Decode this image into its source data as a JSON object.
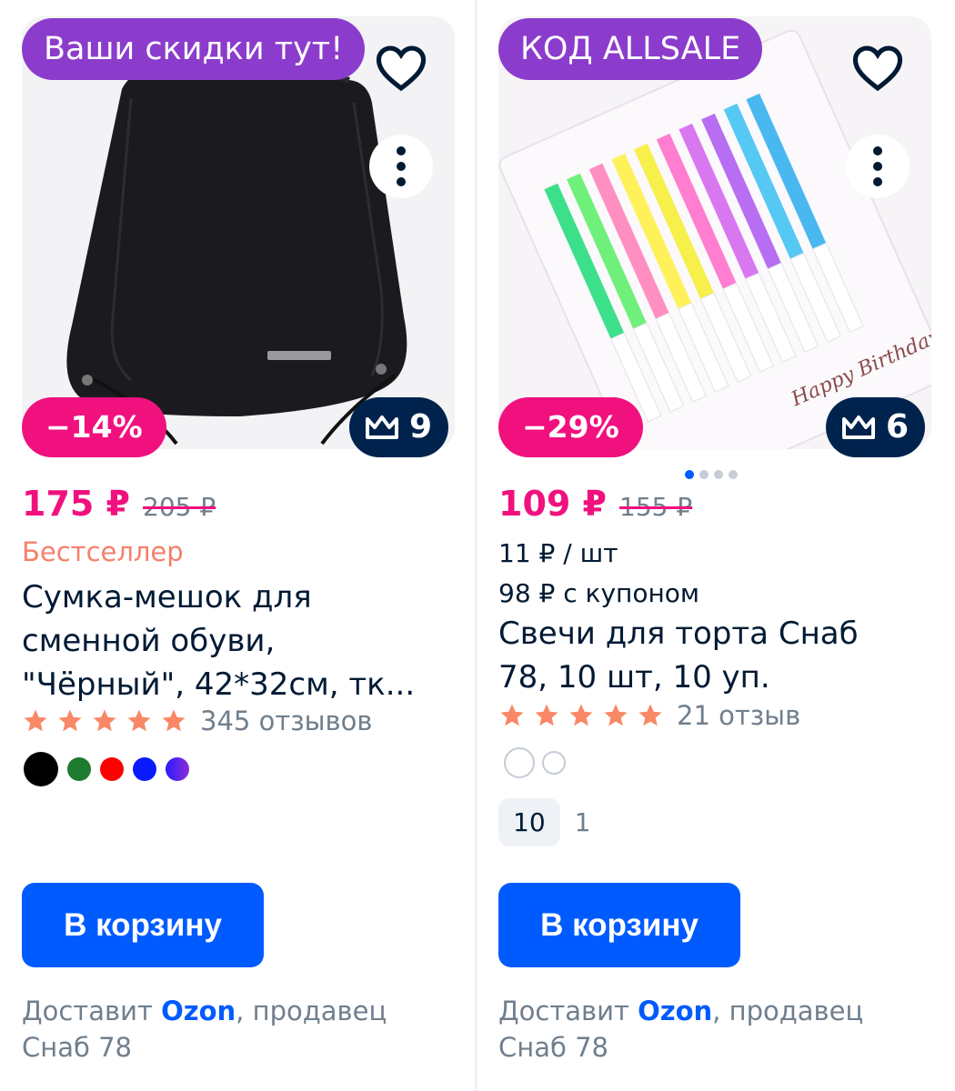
{
  "colors": {
    "accent": "#005bff",
    "discount": "#f1117e",
    "promo": "#8b3ccc",
    "premium": "#00234d",
    "bestseller": "#f5806b",
    "star": "#f98866"
  },
  "products": [
    {
      "promo_badge": "Ваши скидки тут!",
      "discount": "−14%",
      "premium_count": "9",
      "price": "175 ₽",
      "old_price": "205 ₽",
      "tag": "Бестселлер",
      "title_lines": [
        "Сумка-мешок для",
        "сменной обуви,",
        "\"Чёрный\", 42*32см, тк..."
      ],
      "rating_stars": 5,
      "reviews": "345 отзывов",
      "color_swatches": [
        "#000000",
        "#1e7a2e",
        "#ff0000",
        "#0a1aff",
        "#4b2bd6"
      ],
      "button_label": "В корзину",
      "delivery_prefix": "Доставит ",
      "delivery_brand": "Ozon",
      "delivery_suffix": ", продавец",
      "seller": "Снаб 78"
    },
    {
      "promo_badge": "КОД ALLSALE",
      "discount": "−29%",
      "premium_count": "6",
      "image_text": "Happy Birthday",
      "price": "109 ₽",
      "old_price": "155 ₽",
      "unit_price": "11 ₽ / шт",
      "coupon_price": "98 ₽ с купоном",
      "title_lines": [
        "Свечи для торта Снаб",
        "78, 10 шт, 10 уп."
      ],
      "rating_stars": 5,
      "reviews": "21 отзыв",
      "options": [
        "10",
        "1"
      ],
      "carousel_count": 4,
      "carousel_active": 1,
      "button_label": "В корзину",
      "delivery_prefix": "Доставит ",
      "delivery_brand": "Ozon",
      "delivery_suffix": ", продавец",
      "seller": "Снаб 78"
    }
  ],
  "icons": {
    "favorite": "heart-outline-icon",
    "more": "three-dots-vertical-icon",
    "premium": "crown-icon",
    "star": "star-icon"
  }
}
